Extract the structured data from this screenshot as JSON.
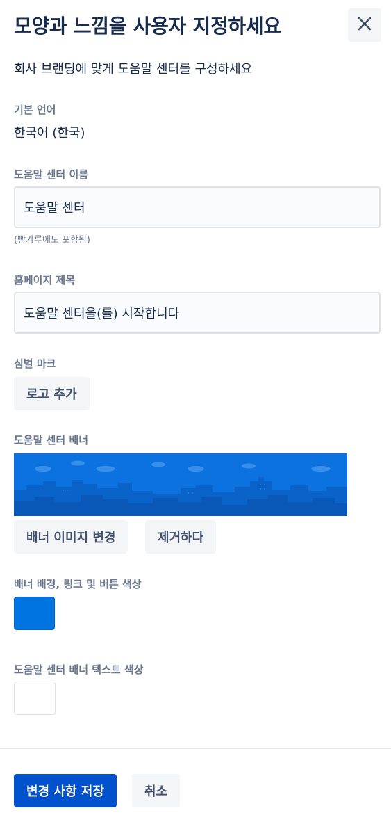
{
  "header": {
    "title": "모양과 느낌을 사용자 지정하세요",
    "subtitle": "회사 브랜딩에 맞게 도움말 센터를 구성하세요"
  },
  "default_language": {
    "label": "기본 언어",
    "value": "한국어 (한국)"
  },
  "help_center_name": {
    "label": "도움말 센터 이름",
    "value": "도움말 센터",
    "helper": "(빵가루에도 포함됨)"
  },
  "homepage_title": {
    "label": "홈페이지 제목",
    "value": "도움말 센터을(를) 시작합니다"
  },
  "logo": {
    "label": "심벌 마크",
    "add_button": "로고 추가"
  },
  "banner": {
    "label": "도움말 센터 배너",
    "change_button": "배너 이미지 변경",
    "remove_button": "제거하다"
  },
  "banner_color": {
    "label": "배너 배경, 링크 및 버튼 색상",
    "color": "#0074E0"
  },
  "banner_text_color": {
    "label": "도움말 센터 배너 텍스트 색상",
    "color": "#FFFFFF"
  },
  "footer": {
    "save_button": "변경 사항 저장",
    "cancel_button": "취소"
  },
  "icons": {
    "close": "close-icon"
  },
  "theme": {
    "primary": "#0052CC",
    "banner_bg": "#0B72E0",
    "label_color": "#6B778C",
    "text_color": "#172B4D"
  }
}
